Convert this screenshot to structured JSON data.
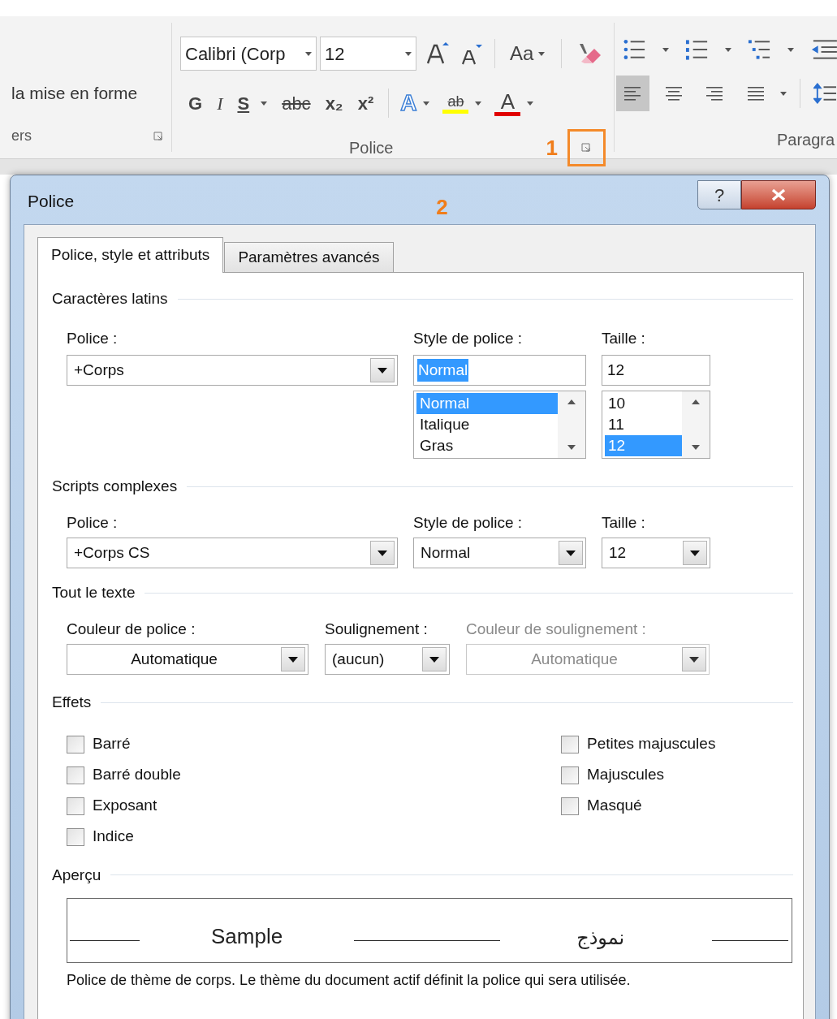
{
  "ribbon": {
    "styles_group": {
      "text": "la mise en forme",
      "label": "ers"
    },
    "font_group": {
      "label": "Police",
      "font_name": "Calibri (Corp",
      "font_size": "12",
      "case_button": "Aa",
      "format_buttons": [
        {
          "kind": "bold",
          "label": "G"
        },
        {
          "kind": "italic",
          "label": "I"
        },
        {
          "kind": "underline",
          "label": "S"
        },
        {
          "kind": "strike",
          "label": "abc"
        },
        {
          "kind": "sub",
          "label": "x₂"
        },
        {
          "kind": "sup",
          "label": "x²"
        }
      ],
      "effects_button": "A",
      "highlight_button": "ab",
      "font_color_button": "A"
    },
    "paragraph_group": {
      "label": "Paragra",
      "align_buttons": [
        {
          "kind": "left",
          "selected": true
        },
        {
          "kind": "center",
          "selected": false
        },
        {
          "kind": "right",
          "selected": false
        },
        {
          "kind": "justify",
          "selected": false
        }
      ]
    }
  },
  "annotations": [
    {
      "label": "1"
    },
    {
      "label": "2"
    }
  ],
  "dialog": {
    "title": "Police",
    "help": "?",
    "tabs": [
      {
        "label": "Police, style et attributs",
        "selected": true
      },
      {
        "label": "Paramètres avancés",
        "selected": false
      }
    ],
    "latin": {
      "heading": "Caractères latins",
      "font_label": "Police :",
      "font_value": "+Corps",
      "style_label": "Style de police :",
      "style_value": "Normal",
      "style_value_highlighted": true,
      "style_list": [
        {
          "label": "Normal",
          "selected": true
        },
        {
          "label": "Italique",
          "selected": false
        },
        {
          "label": "Gras",
          "selected": false
        }
      ],
      "size_label": "Taille :",
      "size_value": "12",
      "size_list": [
        {
          "label": "10",
          "selected": false
        },
        {
          "label": "11",
          "selected": false
        },
        {
          "label": "12",
          "selected": true
        }
      ]
    },
    "complex": {
      "heading": "Scripts complexes",
      "font_label": "Police :",
      "font_value": "+Corps CS",
      "style_label": "Style de police :",
      "style_value": "Normal",
      "size_label": "Taille :",
      "size_value": "12"
    },
    "all_text": {
      "heading": "Tout le texte",
      "combos": [
        {
          "label": "Couleur de police :",
          "value": "Automatique",
          "disabled": false
        },
        {
          "label": "Soulignement :",
          "value": "(aucun)",
          "disabled": false
        },
        {
          "label": "Couleur de soulignement :",
          "value": "Automatique",
          "disabled": true
        }
      ]
    },
    "effects": {
      "heading": "Effets",
      "left": [
        {
          "label": "Barré",
          "checked": false
        },
        {
          "label": "Barré double",
          "checked": false
        },
        {
          "label": "Exposant",
          "checked": false
        },
        {
          "label": "Indice",
          "checked": false
        }
      ],
      "right": [
        {
          "label": "Petites majuscules",
          "checked": false
        },
        {
          "label": "Majuscules",
          "checked": false
        },
        {
          "label": "Masqué",
          "checked": false
        }
      ]
    },
    "preview": {
      "heading": "Aperçu",
      "sample_latin": "Sample",
      "sample_complex": "نموذج",
      "description": "Police de thème de corps. Le thème du document actif définit la police qui sera utilisée."
    }
  }
}
